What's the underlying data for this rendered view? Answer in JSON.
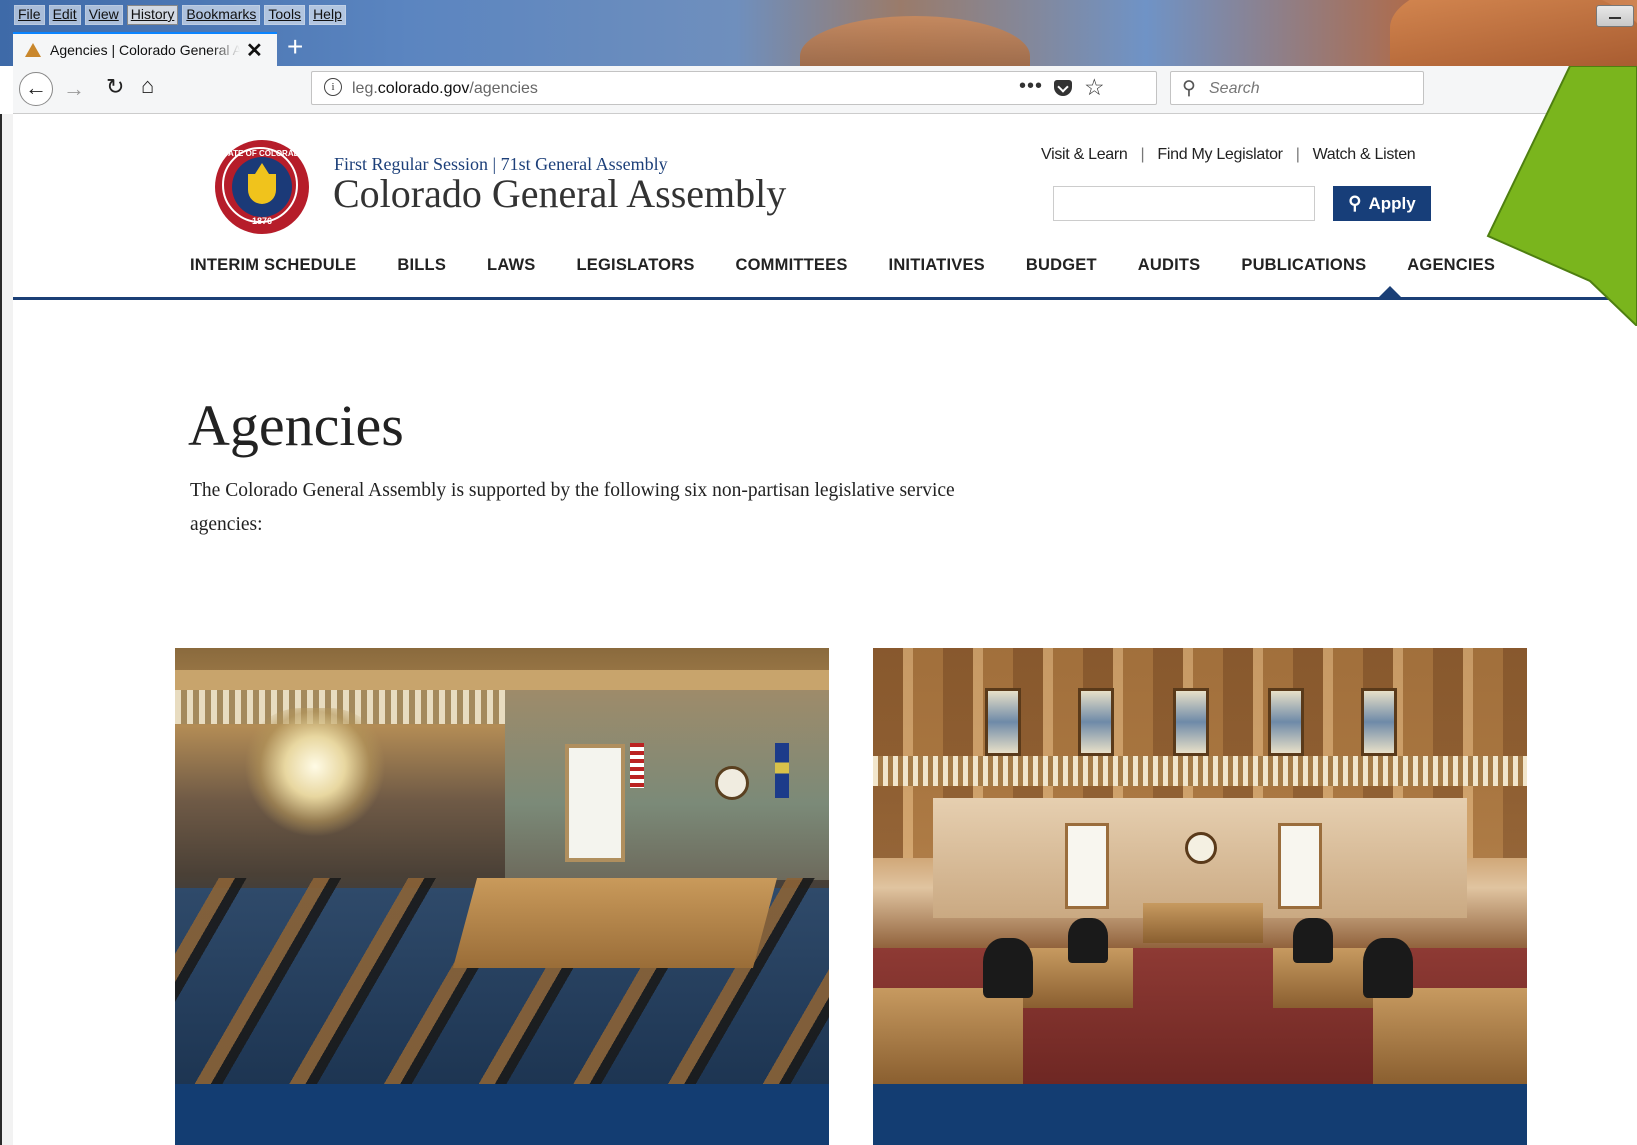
{
  "menubar": {
    "items": [
      "File",
      "Edit",
      "View",
      "History",
      "Bookmarks",
      "Tools",
      "Help"
    ]
  },
  "tab": {
    "title": "Agencies | Colorado General Assembly",
    "close": "✕",
    "new_tab": "+"
  },
  "toolbar": {
    "back": "←",
    "forward": "→",
    "reload": "↻",
    "home": "⌂"
  },
  "urlbar": {
    "host_prefix": "leg.",
    "host": "colorado.gov",
    "path": "/agencies",
    "more": "•••"
  },
  "searchbar": {
    "placeholder": "Search"
  },
  "site": {
    "session": "First Regular Session | 71st General Assembly",
    "title": "Colorado General Assembly",
    "seal": {
      "text": "STATE OF COLORADO",
      "year": "1876"
    }
  },
  "utility_nav": [
    "Visit & Learn",
    "Find My Legislator",
    "Watch & Listen"
  ],
  "site_search": {
    "value": "",
    "button": "Apply"
  },
  "main_nav": [
    {
      "label": "INTERIM SCHEDULE"
    },
    {
      "label": "BILLS"
    },
    {
      "label": "LAWS"
    },
    {
      "label": "LEGISLATORS"
    },
    {
      "label": "COMMITTEES"
    },
    {
      "label": "INITIATIVES"
    },
    {
      "label": "BUDGET"
    },
    {
      "label": "AUDITS"
    },
    {
      "label": "PUBLICATIONS"
    },
    {
      "label": "AGENCIES",
      "active": true
    }
  ],
  "page": {
    "heading": "Agencies",
    "lead": "The Colorado General Assembly is supported by the following six non-partisan legislative service agencies:"
  },
  "colors": {
    "brand_navy": "#173e79",
    "seal_red": "#b61d2a",
    "callout_green": "#7ab51d",
    "tab_accent": "#0a84ff"
  }
}
